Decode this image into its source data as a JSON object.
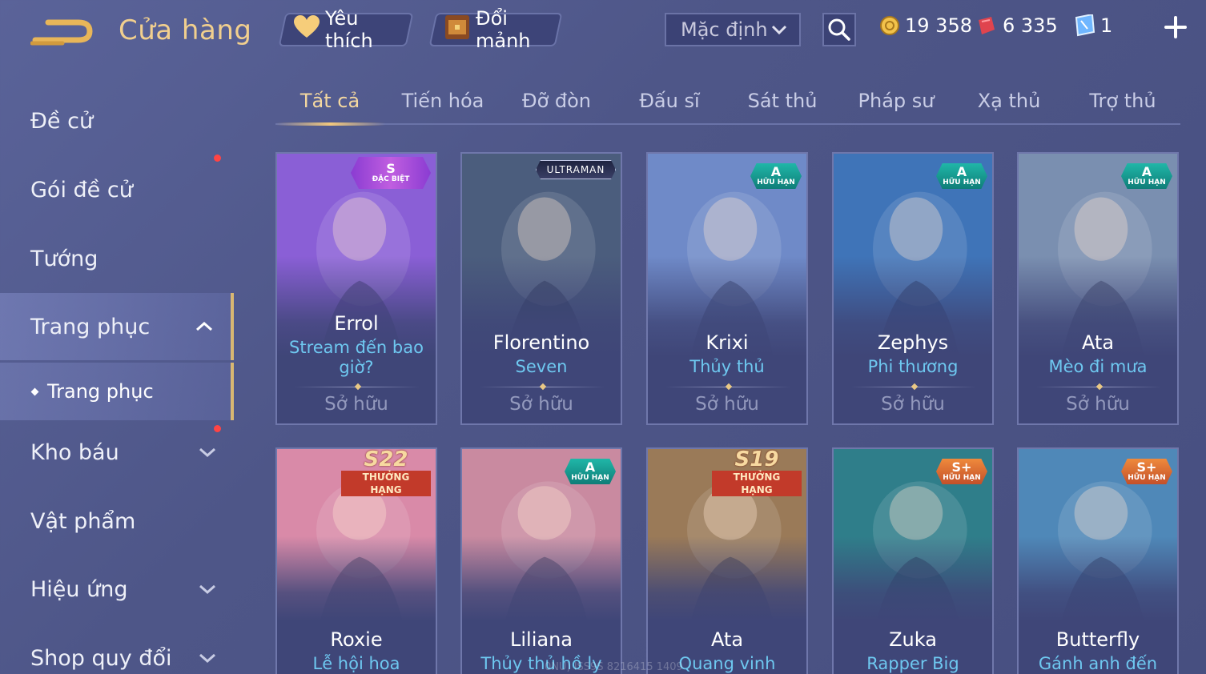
{
  "header": {
    "title": "Cửa hàng",
    "favorites_label": "Yêu thích",
    "exchange_label": "Đổi mảnh",
    "sort_selected": "Mặc định",
    "currencies": [
      {
        "name": "gold-coin",
        "value": "19 358",
        "color": "#f2c24a"
      },
      {
        "name": "red-voucher",
        "value": "6 335",
        "color": "#e0444e"
      },
      {
        "name": "blue-ticket",
        "value": "1",
        "color": "#6fb6ff"
      }
    ]
  },
  "sidebar": {
    "items": [
      {
        "label": "Đề cử"
      },
      {
        "label": "Gói đề cử",
        "has_notification": true
      },
      {
        "label": "Tướng"
      },
      {
        "label": "Trang phục",
        "expanded": true
      },
      {
        "label": "Kho báu",
        "has_notification": true
      },
      {
        "label": "Vật phẩm"
      },
      {
        "label": "Hiệu ứng"
      },
      {
        "label": "Shop quy đổi"
      }
    ],
    "sub_item": "Trang phục"
  },
  "tabs": [
    "Tất cả",
    "Tiến hóa",
    "Đỡ đòn",
    "Đấu sĩ",
    "Sát thủ",
    "Pháp sư",
    "Xạ thủ",
    "Trợ thủ"
  ],
  "active_tab": "Tất cả",
  "cards_row1": [
    {
      "hero": "Errol",
      "skin": "Stream đến bao giờ?",
      "status": "Sở hữu",
      "badge_type": "special",
      "badge_big": "S",
      "badge_small": "ĐẶC BIỆT",
      "accent": "#8a5fd6"
    },
    {
      "hero": "Florentino",
      "skin": "Seven",
      "status": "Sở hữu",
      "badge_type": "ultraman",
      "badge_big": "ULTRAMAN",
      "accent": "#4b5d7d"
    },
    {
      "hero": "Krixi",
      "skin": "Thủy thủ",
      "status": "Sở hữu",
      "badge_type": "limited-a",
      "badge_big": "A",
      "badge_small": "HỮU HẠN",
      "accent": "#6f8ac8"
    },
    {
      "hero": "Zephys",
      "skin": "Phi thương",
      "status": "Sở hữu",
      "badge_type": "limited-a",
      "badge_big": "A",
      "badge_small": "HỮU HẠN",
      "accent": "#3f74b8"
    },
    {
      "hero": "Ata",
      "skin": "Mèo đi mưa",
      "status": "Sở hữu",
      "badge_type": "limited-a",
      "badge_big": "A",
      "badge_small": "HỮU HẠN",
      "accent": "#7a8fb0"
    }
  ],
  "cards_row2": [
    {
      "hero": "Roxie",
      "skin": "Lễ hội hoa",
      "badge_type": "season",
      "badge_big": "S22",
      "badge_small": "THƯỞNG HẠNG",
      "accent": "#d98aa8"
    },
    {
      "hero": "Liliana",
      "skin": "Thủy thủ hồ ly",
      "badge_type": "limited-a",
      "badge_big": "A",
      "badge_small": "HỮU HẠN",
      "accent": "#c98aa0"
    },
    {
      "hero": "Ata",
      "skin": "Quang vinh",
      "badge_type": "season",
      "badge_big": "S19",
      "badge_small": "THƯỞNG HẠNG",
      "accent": "#9a7a58"
    },
    {
      "hero": "Zuka",
      "skin": "Rapper Big Panda",
      "badge_type": "limited-s",
      "badge_big": "S+",
      "badge_small": "HỮU HẠN",
      "accent": "#2f7e8a"
    },
    {
      "hero": "Butterfly",
      "skin": "Gánh anh đến cùng",
      "badge_type": "limited-s",
      "badge_big": "S+",
      "badge_small": "HỮU HẠN",
      "accent": "#4f88b8"
    }
  ],
  "watermark": "0NU) ISS9S 8216415 1409"
}
